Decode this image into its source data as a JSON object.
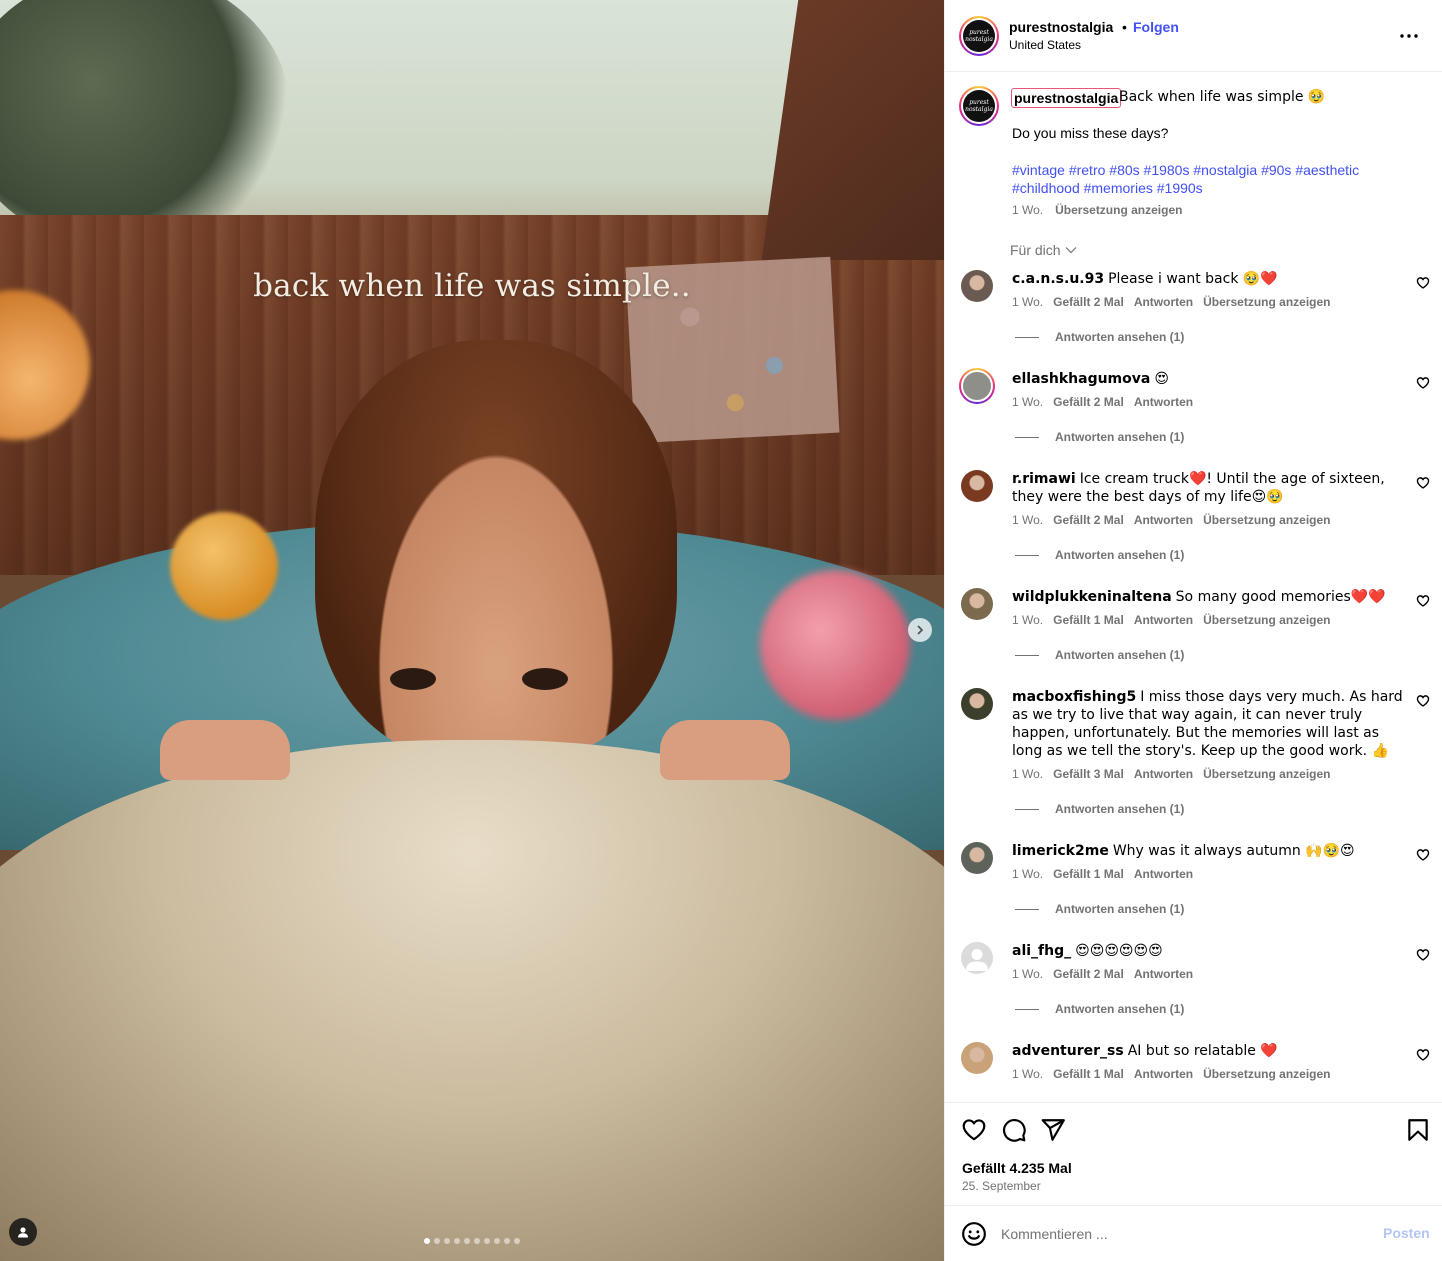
{
  "media": {
    "overlay_text": "back when life was simple..",
    "carousel_count": 10,
    "carousel_active": 0
  },
  "header": {
    "username": "purestnostalgia",
    "separator": "•",
    "follow_label": "Folgen",
    "location": "United States",
    "logo_text": "purest nostalgia"
  },
  "caption": {
    "username": "purestnostalgia",
    "text": "Back when life was simple 🥹",
    "line2": "Do you miss these days?",
    "hashtags": "#vintage #retro #80s #1980s #nostalgia #90s #aesthetic #childhood #memories #1990s",
    "time": "1 Wo.",
    "translate": "Übersetzung anzeigen"
  },
  "filter_label": "Für dich",
  "comments": [
    {
      "username": "c.a.n.s.u.93",
      "text": "Please i want back 🥹❤️",
      "time": "1 Wo.",
      "likes": "Gefällt 2 Mal",
      "reply": "Antworten",
      "translate": "Übersetzung anzeigen",
      "replies": "Antworten ansehen (1)",
      "avatar_color": "#6a5a52"
    },
    {
      "username": "ellashkhagumova",
      "text": "😍",
      "time": "1 Wo.",
      "likes": "Gefällt 2 Mal",
      "reply": "Antworten",
      "translate": "",
      "replies": "Antworten ansehen (1)",
      "avatar_color": "#8d8f88"
    },
    {
      "username": "r.rimawi",
      "text": "Ice cream truck❤️! Until the age of sixteen, they were the best days of my life😍🥹",
      "time": "1 Wo.",
      "likes": "Gefällt 2 Mal",
      "reply": "Antworten",
      "translate": "Übersetzung anzeigen",
      "replies": "Antworten ansehen (1)",
      "avatar_color": "#7a3a22"
    },
    {
      "username": "wildplukkeninaltena",
      "text": "So many good memories❤️❤️",
      "time": "1 Wo.",
      "likes": "Gefällt 1 Mal",
      "reply": "Antworten",
      "translate": "Übersetzung anzeigen",
      "replies": "Antworten ansehen (1)",
      "avatar_color": "#7b6a4e"
    },
    {
      "username": "macboxfishing5",
      "text": "I miss those days very much. As hard as we try to live that way again, it can never truly happen, unfortunately. But the memories will last as long as we tell the story's. Keep up the good work. 👍",
      "time": "1 Wo.",
      "likes": "Gefällt 3 Mal",
      "reply": "Antworten",
      "translate": "Übersetzung anzeigen",
      "replies": "Antworten ansehen (1)",
      "avatar_color": "#3b3f2c"
    },
    {
      "username": "limerick2me",
      "text": "Why was it always autumn 🙌🥹😍",
      "time": "1 Wo.",
      "likes": "Gefällt 1 Mal",
      "reply": "Antworten",
      "translate": "",
      "replies": "Antworten ansehen (1)",
      "avatar_color": "#5d625a"
    },
    {
      "username": "ali_fhg_",
      "text": "😍😍😍😍😍😍",
      "time": "1 Wo.",
      "likes": "Gefällt 2 Mal",
      "reply": "Antworten",
      "translate": "",
      "replies": "Antworten ansehen (1)",
      "avatar_color": "#dbdbdb"
    },
    {
      "username": "adventurer_ss",
      "text": "AI but so relatable ❤️",
      "time": "1 Wo.",
      "likes": "Gefällt 1 Mal",
      "reply": "Antworten",
      "translate": "Übersetzung anzeigen",
      "replies": "",
      "avatar_color": "#c9a27a"
    }
  ],
  "actions": {
    "likes_label": "Gefällt 4.235 Mal",
    "date": "25. September"
  },
  "composer": {
    "placeholder": "Kommentieren ...",
    "post_label": "Posten"
  },
  "colors": {
    "accent": "#4150f7",
    "muted": "#737373",
    "post_disabled": "#b3c6f7"
  },
  "icons": [
    "chevron-right-icon",
    "user-tag-icon",
    "more-icon",
    "chevron-down-icon",
    "heart-icon",
    "comment-icon",
    "share-icon",
    "bookmark-icon",
    "emoji-icon"
  ]
}
